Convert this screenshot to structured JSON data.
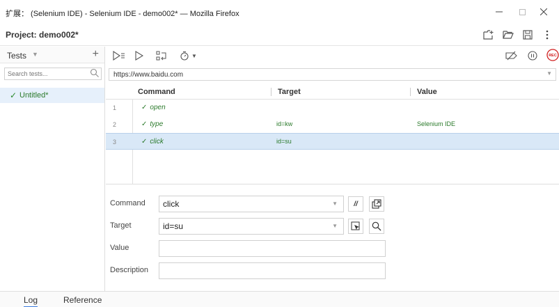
{
  "window": {
    "title": "扩展： (Selenium IDE) - Selenium IDE - demo002* — Mozilla Firefox"
  },
  "project": {
    "title": "Project: demo002*"
  },
  "sidebar": {
    "header_label": "Tests",
    "search_placeholder": "Search tests...",
    "tests": [
      {
        "name": "Untitled*",
        "check": "✓"
      }
    ]
  },
  "url": {
    "value": "https://www.baidu.com"
  },
  "table": {
    "columns": [
      "Command",
      "Target",
      "Value"
    ],
    "rows": [
      {
        "num": "1",
        "check": "✓",
        "command": "open",
        "target": "",
        "value": ""
      },
      {
        "num": "2",
        "check": "✓",
        "command": "type",
        "target": "id=kw",
        "value": "Selenium IDE"
      },
      {
        "num": "3",
        "check": "✓",
        "command": "click",
        "target": "id=su",
        "value": ""
      }
    ],
    "selected_row": 3
  },
  "editor": {
    "command_label": "Command",
    "command_value": "click",
    "target_label": "Target",
    "target_value": "id=su",
    "value_label": "Value",
    "value_value": "",
    "description_label": "Description",
    "description_value": "",
    "comment_glyph": "//"
  },
  "bottom_tabs": {
    "log": "Log",
    "reference": "Reference",
    "active": "log"
  },
  "toolbar": {
    "rec_label": "REC"
  },
  "colors": {
    "accent": "#3c7be0",
    "selected_row": "#d9e8f7",
    "command_green": "#2b7a2b",
    "rec_red": "#d02020"
  }
}
